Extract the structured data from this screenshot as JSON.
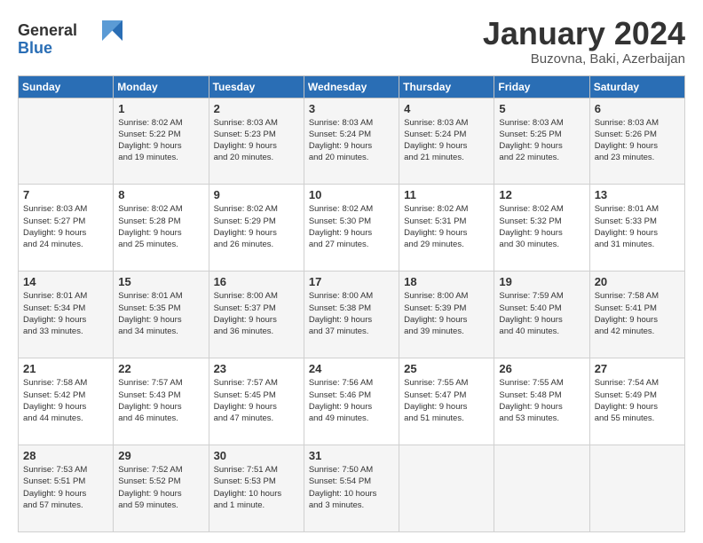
{
  "logo": {
    "line1": "General",
    "line2": "Blue"
  },
  "title": "January 2024",
  "subtitle": "Buzovna, Baki, Azerbaijan",
  "weekdays": [
    "Sunday",
    "Monday",
    "Tuesday",
    "Wednesday",
    "Thursday",
    "Friday",
    "Saturday"
  ],
  "weeks": [
    [
      {
        "day": "",
        "info": ""
      },
      {
        "day": "1",
        "info": "Sunrise: 8:02 AM\nSunset: 5:22 PM\nDaylight: 9 hours\nand 19 minutes."
      },
      {
        "day": "2",
        "info": "Sunrise: 8:03 AM\nSunset: 5:23 PM\nDaylight: 9 hours\nand 20 minutes."
      },
      {
        "day": "3",
        "info": "Sunrise: 8:03 AM\nSunset: 5:24 PM\nDaylight: 9 hours\nand 20 minutes."
      },
      {
        "day": "4",
        "info": "Sunrise: 8:03 AM\nSunset: 5:24 PM\nDaylight: 9 hours\nand 21 minutes."
      },
      {
        "day": "5",
        "info": "Sunrise: 8:03 AM\nSunset: 5:25 PM\nDaylight: 9 hours\nand 22 minutes."
      },
      {
        "day": "6",
        "info": "Sunrise: 8:03 AM\nSunset: 5:26 PM\nDaylight: 9 hours\nand 23 minutes."
      }
    ],
    [
      {
        "day": "7",
        "info": "Sunrise: 8:03 AM\nSunset: 5:27 PM\nDaylight: 9 hours\nand 24 minutes."
      },
      {
        "day": "8",
        "info": "Sunrise: 8:02 AM\nSunset: 5:28 PM\nDaylight: 9 hours\nand 25 minutes."
      },
      {
        "day": "9",
        "info": "Sunrise: 8:02 AM\nSunset: 5:29 PM\nDaylight: 9 hours\nand 26 minutes."
      },
      {
        "day": "10",
        "info": "Sunrise: 8:02 AM\nSunset: 5:30 PM\nDaylight: 9 hours\nand 27 minutes."
      },
      {
        "day": "11",
        "info": "Sunrise: 8:02 AM\nSunset: 5:31 PM\nDaylight: 9 hours\nand 29 minutes."
      },
      {
        "day": "12",
        "info": "Sunrise: 8:02 AM\nSunset: 5:32 PM\nDaylight: 9 hours\nand 30 minutes."
      },
      {
        "day": "13",
        "info": "Sunrise: 8:01 AM\nSunset: 5:33 PM\nDaylight: 9 hours\nand 31 minutes."
      }
    ],
    [
      {
        "day": "14",
        "info": "Sunrise: 8:01 AM\nSunset: 5:34 PM\nDaylight: 9 hours\nand 33 minutes."
      },
      {
        "day": "15",
        "info": "Sunrise: 8:01 AM\nSunset: 5:35 PM\nDaylight: 9 hours\nand 34 minutes."
      },
      {
        "day": "16",
        "info": "Sunrise: 8:00 AM\nSunset: 5:37 PM\nDaylight: 9 hours\nand 36 minutes."
      },
      {
        "day": "17",
        "info": "Sunrise: 8:00 AM\nSunset: 5:38 PM\nDaylight: 9 hours\nand 37 minutes."
      },
      {
        "day": "18",
        "info": "Sunrise: 8:00 AM\nSunset: 5:39 PM\nDaylight: 9 hours\nand 39 minutes."
      },
      {
        "day": "19",
        "info": "Sunrise: 7:59 AM\nSunset: 5:40 PM\nDaylight: 9 hours\nand 40 minutes."
      },
      {
        "day": "20",
        "info": "Sunrise: 7:58 AM\nSunset: 5:41 PM\nDaylight: 9 hours\nand 42 minutes."
      }
    ],
    [
      {
        "day": "21",
        "info": "Sunrise: 7:58 AM\nSunset: 5:42 PM\nDaylight: 9 hours\nand 44 minutes."
      },
      {
        "day": "22",
        "info": "Sunrise: 7:57 AM\nSunset: 5:43 PM\nDaylight: 9 hours\nand 46 minutes."
      },
      {
        "day": "23",
        "info": "Sunrise: 7:57 AM\nSunset: 5:45 PM\nDaylight: 9 hours\nand 47 minutes."
      },
      {
        "day": "24",
        "info": "Sunrise: 7:56 AM\nSunset: 5:46 PM\nDaylight: 9 hours\nand 49 minutes."
      },
      {
        "day": "25",
        "info": "Sunrise: 7:55 AM\nSunset: 5:47 PM\nDaylight: 9 hours\nand 51 minutes."
      },
      {
        "day": "26",
        "info": "Sunrise: 7:55 AM\nSunset: 5:48 PM\nDaylight: 9 hours\nand 53 minutes."
      },
      {
        "day": "27",
        "info": "Sunrise: 7:54 AM\nSunset: 5:49 PM\nDaylight: 9 hours\nand 55 minutes."
      }
    ],
    [
      {
        "day": "28",
        "info": "Sunrise: 7:53 AM\nSunset: 5:51 PM\nDaylight: 9 hours\nand 57 minutes."
      },
      {
        "day": "29",
        "info": "Sunrise: 7:52 AM\nSunset: 5:52 PM\nDaylight: 9 hours\nand 59 minutes."
      },
      {
        "day": "30",
        "info": "Sunrise: 7:51 AM\nSunset: 5:53 PM\nDaylight: 10 hours\nand 1 minute."
      },
      {
        "day": "31",
        "info": "Sunrise: 7:50 AM\nSunset: 5:54 PM\nDaylight: 10 hours\nand 3 minutes."
      },
      {
        "day": "",
        "info": ""
      },
      {
        "day": "",
        "info": ""
      },
      {
        "day": "",
        "info": ""
      }
    ]
  ]
}
